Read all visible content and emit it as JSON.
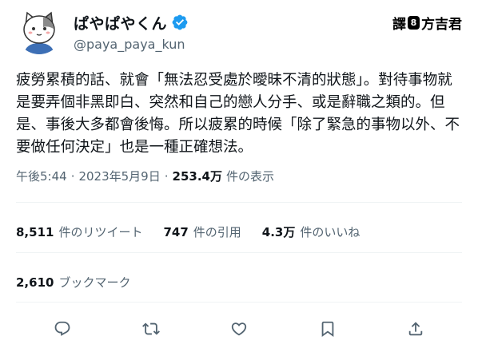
{
  "user": {
    "display_name": "ぱやぱやくん",
    "handle": "@paya_paya_kun",
    "verified_icon": "verified-badge-icon",
    "avatar_icon": "cat-avatar"
  },
  "watermark": {
    "prefix": "譯",
    "badge": "8",
    "text": "方吉君"
  },
  "tweet": {
    "text": "疲勞累積的話、就會「無法忍受處於曖昧不清的狀態」。對待事物就是要弄個非黑即白、突然和自己的戀人分手、或是辭職之類的。但是、事後大多都會後悔。所以疲累的時候「除了緊急的事物以外、不要做任何決定」也是一種正確想法。"
  },
  "meta": {
    "time": "午後5:44",
    "separator": "·",
    "date": "2023年5月9日",
    "views_count": "253.4万",
    "views_label": "件の表示"
  },
  "stats": {
    "retweets_count": "8,511",
    "retweets_label": "件のリツイート",
    "quotes_count": "747",
    "quotes_label": "件の引用",
    "likes_count": "4.3万",
    "likes_label": "件のいいね",
    "bookmarks_count": "2,610",
    "bookmarks_label": "ブックマーク"
  },
  "actions": [
    {
      "name": "reply",
      "icon": "reply-icon"
    },
    {
      "name": "retweet",
      "icon": "retweet-icon"
    },
    {
      "name": "like",
      "icon": "heart-icon"
    },
    {
      "name": "bookmark",
      "icon": "bookmark-icon"
    },
    {
      "name": "share",
      "icon": "share-icon"
    }
  ],
  "colors": {
    "text": "#0f1419",
    "secondary": "#536471",
    "verified": "#1d9bf0",
    "divider": "#eff3f4"
  }
}
